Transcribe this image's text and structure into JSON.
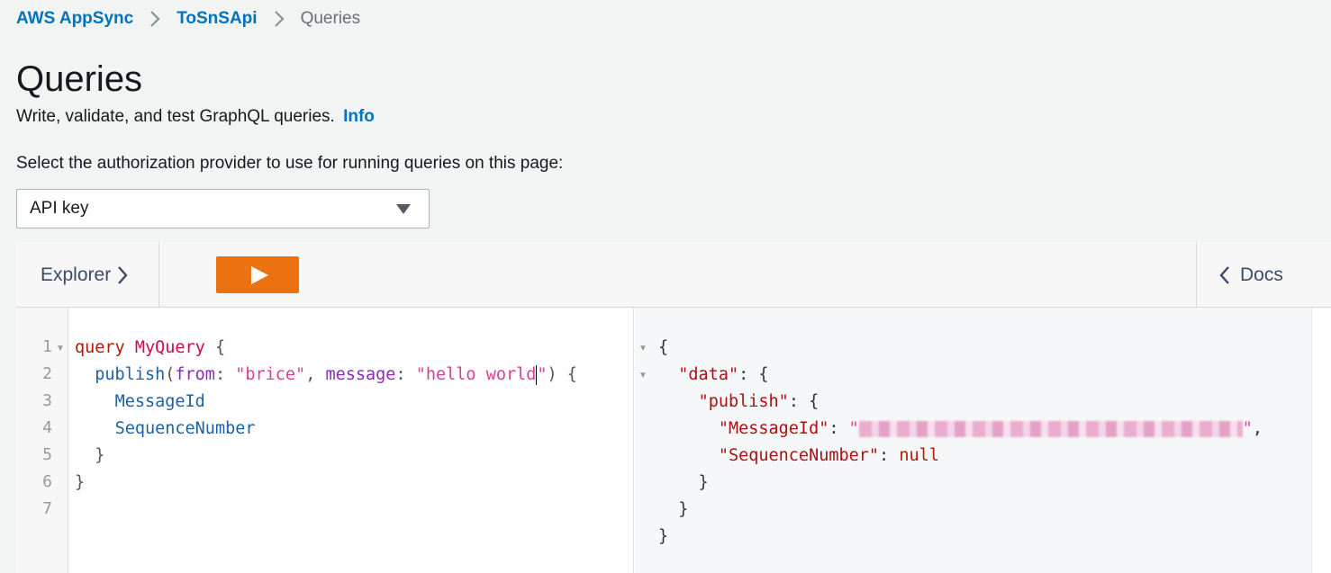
{
  "breadcrumb": {
    "items": [
      "AWS AppSync",
      "ToSnSApi"
    ],
    "current": "Queries"
  },
  "page": {
    "title": "Queries",
    "subtitle": "Write, validate, and test GraphQL queries.",
    "info_link": "Info"
  },
  "auth": {
    "label": "Select the authorization provider to use for running queries on this page:",
    "selected": "API key"
  },
  "toolbar": {
    "explorer_label": "Explorer",
    "docs_label": "Docs",
    "run_icon": "play-icon"
  },
  "editor": {
    "line_numbers": [
      "1",
      "2",
      "3",
      "4",
      "5",
      "6",
      "7"
    ],
    "query_keyword": "query",
    "operation_name": "MyQuery",
    "field": "publish",
    "arg1_name": "from",
    "arg1_value": "\"brice\"",
    "arg2_name": "message",
    "arg2_value_before_cursor": "\"hello world",
    "arg2_value_after_cursor": "\"",
    "selection1": "MessageId",
    "selection2": "SequenceNumber"
  },
  "result": {
    "key_data": "\"data\"",
    "key_publish": "\"publish\"",
    "key_message_id": "\"MessageId\"",
    "key_sequence": "\"SequenceNumber\"",
    "sequence_value": "null"
  },
  "colors": {
    "link": "#0073bb",
    "run_button": "#ec7211"
  }
}
